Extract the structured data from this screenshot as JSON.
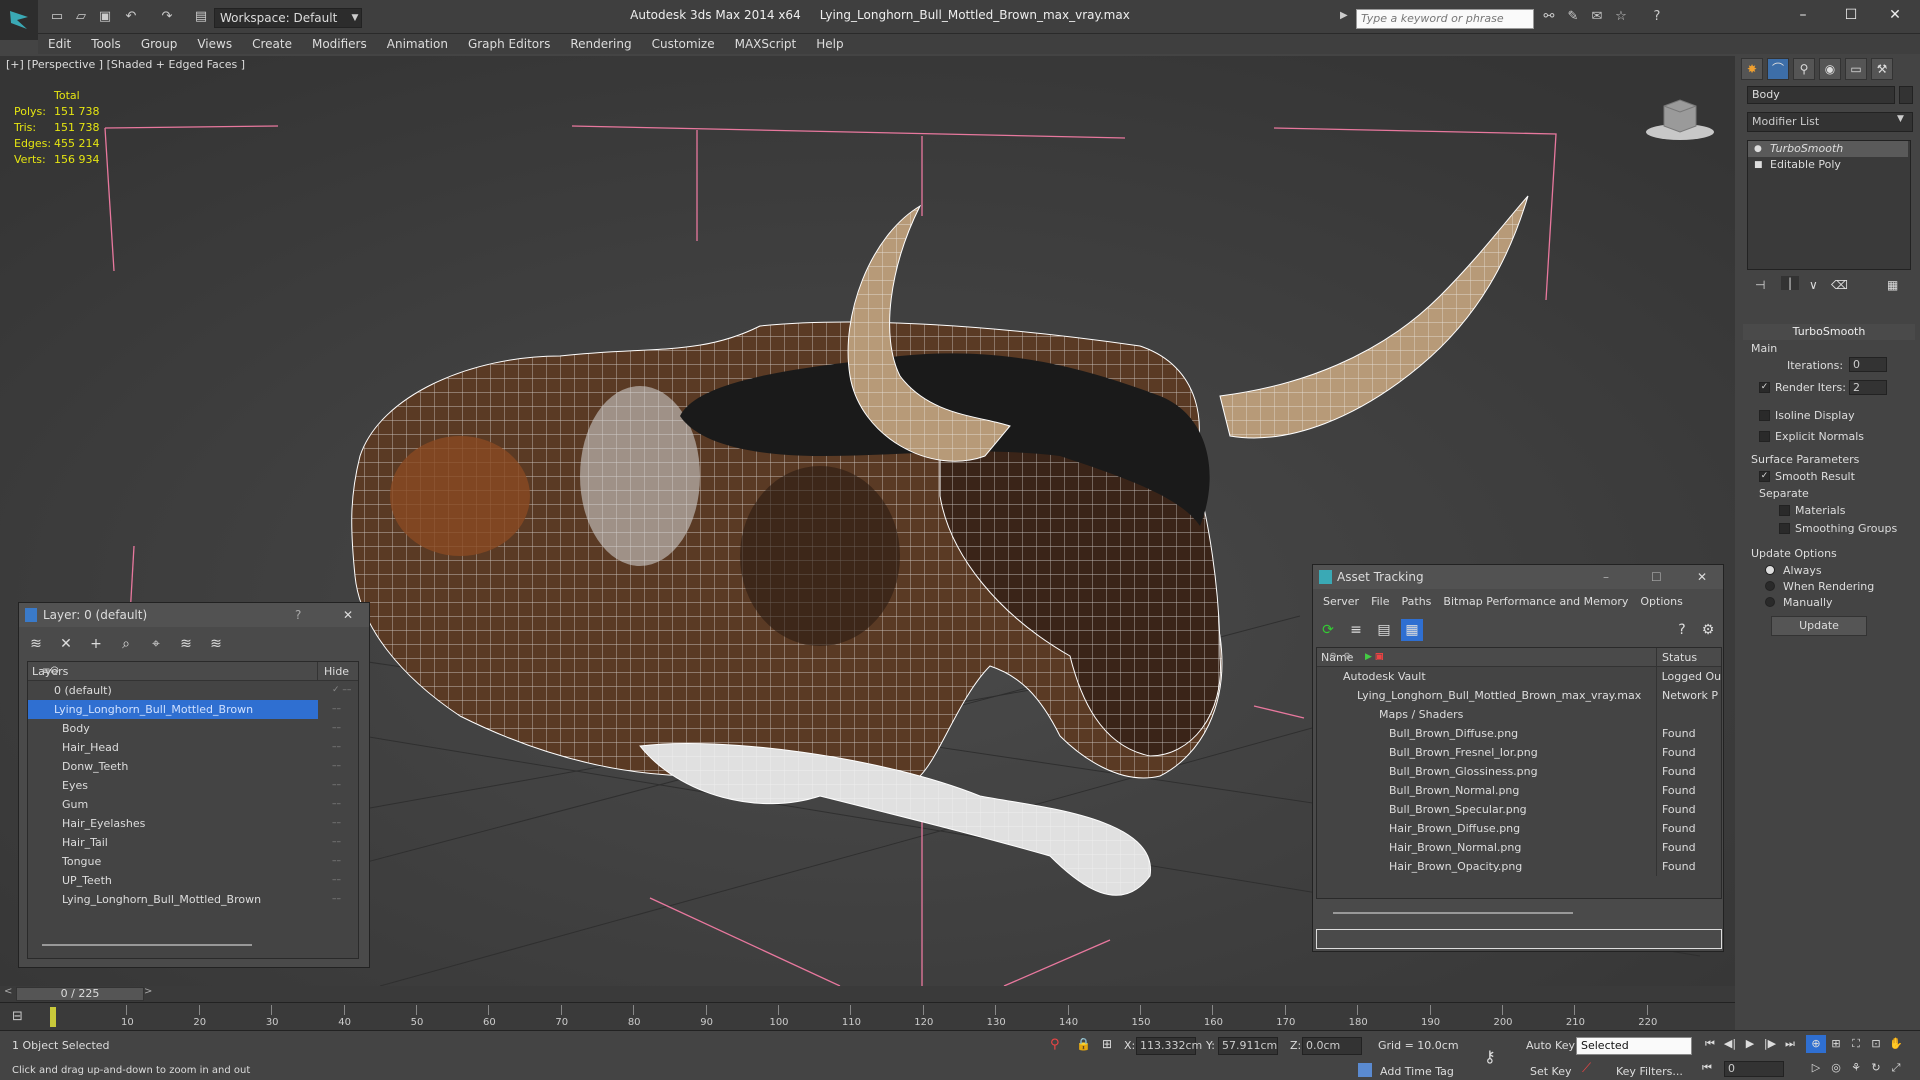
{
  "titlebar": {
    "workspace": "Workspace: Default",
    "app_title": "Autodesk 3ds Max  2014 x64",
    "file_name": "Lying_Longhorn_Bull_Mottled_Brown_max_vray.max",
    "search_placeholder": "Type a keyword or phrase"
  },
  "menu": [
    "Edit",
    "Tools",
    "Group",
    "Views",
    "Create",
    "Modifiers",
    "Animation",
    "Graph Editors",
    "Rendering",
    "Customize",
    "MAXScript",
    "Help"
  ],
  "viewport": {
    "label": "[+] [Perspective ] [Shaded + Edged Faces ]",
    "stats": {
      "header": "Total",
      "polys_label": "Polys:",
      "polys": "151 738",
      "tris_label": "Tris:",
      "tris": "151 738",
      "edges_label": "Edges:",
      "edges": "455 214",
      "verts_label": "Verts:",
      "verts": "156 934"
    }
  },
  "command_panel": {
    "object_name": "Body",
    "modifier_list": "Modifier List",
    "stack": [
      "TurboSmooth",
      "Editable Poly"
    ],
    "rollout_title": "TurboSmooth",
    "main_label": "Main",
    "iterations_label": "Iterations:",
    "iterations": "0",
    "render_iters_label": "Render Iters:",
    "render_iters": "2",
    "isoline": "Isoline Display",
    "explicit_normals": "Explicit Normals",
    "surface_params": "Surface Parameters",
    "smooth_result": "Smooth Result",
    "separate": "Separate",
    "materials": "Materials",
    "smoothing_groups": "Smoothing Groups",
    "update_options": "Update Options",
    "always": "Always",
    "when_rendering": "When Rendering",
    "manually": "Manually",
    "update_btn": "Update"
  },
  "layer_panel": {
    "title": "Layer: 0 (default)",
    "help": "?",
    "col_layers": "Layers",
    "col_hide": "Hide",
    "layers": [
      {
        "name": "0 (default)",
        "indent": 1
      },
      {
        "name": "Lying_Longhorn_Bull_Mottled_Brown",
        "indent": 1,
        "selected": true
      },
      {
        "name": "Body",
        "indent": 2
      },
      {
        "name": "Hair_Head",
        "indent": 2
      },
      {
        "name": "Donw_Teeth",
        "indent": 2
      },
      {
        "name": "Eyes",
        "indent": 2
      },
      {
        "name": "Gum",
        "indent": 2
      },
      {
        "name": "Hair_Eyelashes",
        "indent": 2
      },
      {
        "name": "Hair_Tail",
        "indent": 2
      },
      {
        "name": "Tongue",
        "indent": 2
      },
      {
        "name": "UP_Teeth",
        "indent": 2
      },
      {
        "name": "Lying_Longhorn_Bull_Mottled_Brown",
        "indent": 2
      }
    ]
  },
  "asset_panel": {
    "title": "Asset Tracking",
    "menu": [
      "Server",
      "File",
      "Paths",
      "Bitmap Performance and Memory",
      "Options"
    ],
    "col_name": "Name",
    "col_status": "Status",
    "rows": [
      {
        "name": "Autodesk Vault",
        "status": "Logged Ou",
        "indent": 1
      },
      {
        "name": "Lying_Longhorn_Bull_Mottled_Brown_max_vray.max",
        "status": "Network P",
        "indent": 2
      },
      {
        "name": "Maps / Shaders",
        "status": "",
        "indent": 3
      },
      {
        "name": "Bull_Brown_Diffuse.png",
        "status": "Found",
        "indent": 4
      },
      {
        "name": "Bull_Brown_Fresnel_Ior.png",
        "status": "Found",
        "indent": 4
      },
      {
        "name": "Bull_Brown_Glossiness.png",
        "status": "Found",
        "indent": 4
      },
      {
        "name": "Bull_Brown_Normal.png",
        "status": "Found",
        "indent": 4
      },
      {
        "name": "Bull_Brown_Specular.png",
        "status": "Found",
        "indent": 4
      },
      {
        "name": "Hair_Brown_Diffuse.png",
        "status": "Found",
        "indent": 4
      },
      {
        "name": "Hair_Brown_Normal.png",
        "status": "Found",
        "indent": 4
      },
      {
        "name": "Hair_Brown_Opacity.png",
        "status": "Found",
        "indent": 4
      }
    ]
  },
  "timeline": {
    "frame": "0 / 225",
    "ticks": [
      "10",
      "20",
      "30",
      "40",
      "50",
      "60",
      "70",
      "80",
      "90",
      "100",
      "110",
      "120",
      "130",
      "140",
      "150",
      "160",
      "170",
      "180",
      "190",
      "200",
      "210",
      "220"
    ]
  },
  "status": {
    "selection": "1 Object Selected",
    "prompt": "Click and drag up-and-down to zoom in and out",
    "x_label": "X:",
    "x": "113.332cm",
    "y_label": "Y:",
    "y": "57.911cm",
    "z_label": "Z:",
    "z": "0.0cm",
    "grid": "Grid = 10.0cm",
    "add_time_tag": "Add Time Tag",
    "auto_key": "Auto Key",
    "selected": "Selected",
    "set_key": "Set Key",
    "key_filters": "Key Filters...",
    "current_frame": "0"
  },
  "colors": {
    "accent": "#2f6fd1",
    "stats": "#e5e511",
    "bounds": "#e8789e"
  }
}
